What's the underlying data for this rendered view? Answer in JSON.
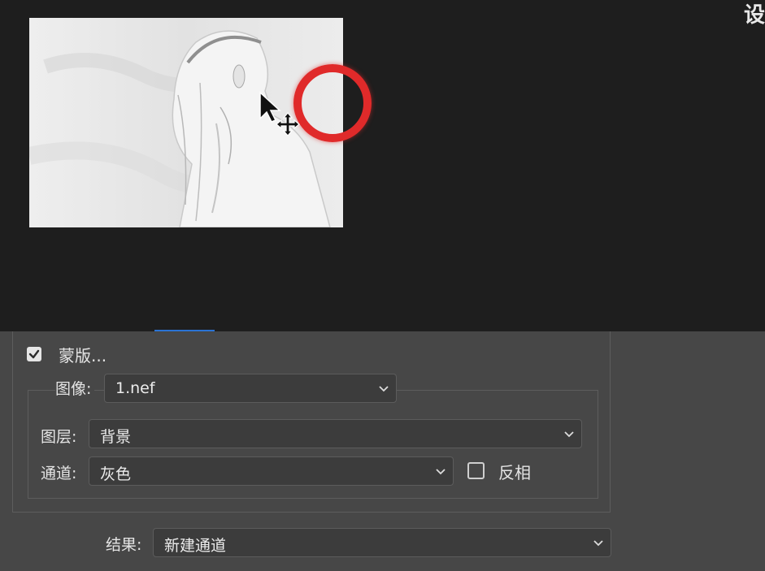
{
  "corner_text": "设",
  "mask": {
    "checked": true,
    "label": "蒙版..."
  },
  "image": {
    "label": "图像:",
    "value": "1.nef"
  },
  "layer": {
    "label": "图层:",
    "value": "背景"
  },
  "channel": {
    "label": "通道:",
    "value": "灰色"
  },
  "invert": {
    "checked": false,
    "label": "反相"
  },
  "result": {
    "label": "结果:",
    "value": "新建通道"
  },
  "icons": [
    "checkmark-icon",
    "chevron-down-icon",
    "cursor-arrow-icon",
    "move-icon"
  ],
  "colors": {
    "highlight_ring": "#e02a2a",
    "panel_bg": "#474747",
    "canvas_bg": "#1e1e1e"
  }
}
